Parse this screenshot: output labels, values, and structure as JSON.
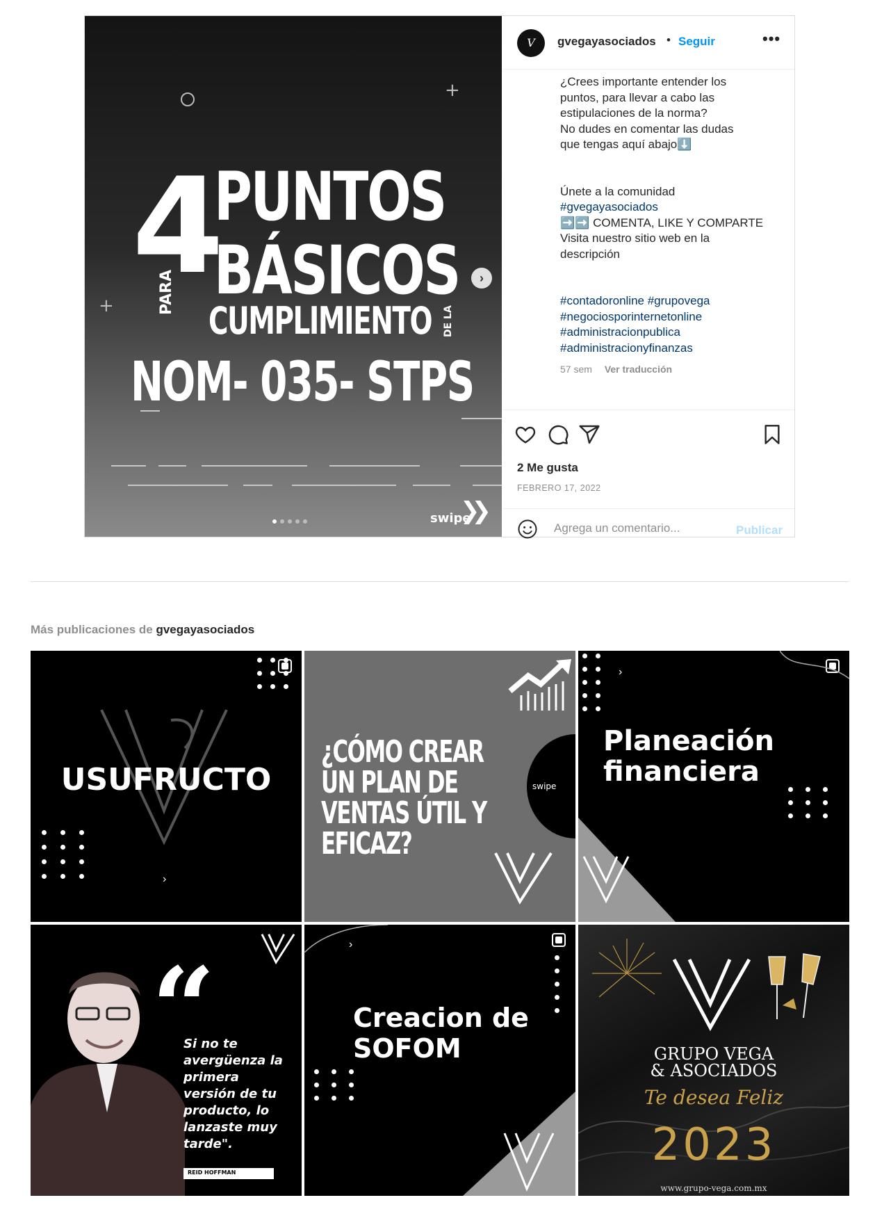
{
  "post": {
    "image": {
      "big_number": "4",
      "line1": "PUNTOS",
      "line2": "BÁSICOS",
      "para": "PARA",
      "line3": "CUMPLIMIENTO",
      "de_la": "DE LA",
      "line4": "NOM- 035- STPS",
      "swipe": "swipe",
      "carousel_slides": 5,
      "carousel_active_index": 0
    },
    "header": {
      "username": "gvegayasociados",
      "separator": "•",
      "follow_label": "Seguir",
      "more_label": "•••"
    },
    "caption": {
      "paragraph1": "¿Crees importante entender los\npuntos, para llevar a cabo las\nestipulaciones de la norma?\nNo dudes en comentar las dudas\nque tengas aquí abajo⬇️",
      "join_text": "Únete a la comunidad",
      "community_tag": "#gvegayasociados",
      "cta_text": "COMENTA, LIKE Y COMPARTE",
      "cta_emoji": "➡️➡️",
      "website_text": "Visita nuestro sitio web en la\ndescripción",
      "hashtags": [
        "#contadoronline #grupovega",
        "#negociosporinternetonline",
        "#administracionpublica",
        "#administracionyfinanzas"
      ]
    },
    "meta": {
      "age": "57 sem",
      "translate_label": "Ver traducción"
    },
    "likes": "2 Me gusta",
    "date": "FEBRERO 17, 2022",
    "comment": {
      "placeholder": "Agrega un comentario...",
      "value": "",
      "publish_label": "Publicar"
    }
  },
  "more_posts": {
    "title_prefix": "Más publicaciones de",
    "owner": "gvegayasociados",
    "tiles": [
      {
        "text": "USUFRUCTO",
        "multi": true
      },
      {
        "text": "¿CÓMO CREAR UN PLAN DE VENTAS ÚTIL Y EFICAZ?",
        "badge": "swipe",
        "multi": false
      },
      {
        "text": "Planeación financiera",
        "multi": true
      },
      {
        "quote": "Si no te avergüenza la primera versión de tu producto, lo lanzaste muy tarde\".",
        "author": "REID HOFFMAN",
        "multi": false
      },
      {
        "text": "Creacion de SOFOM",
        "multi": true
      },
      {
        "brand": "GRUPO VEGA & ASOCIADOS",
        "greeting": "Te desea Feliz",
        "year": "2023",
        "website": "www.grupo-vega.com.mx",
        "multi": false
      }
    ]
  },
  "colors": {
    "accent": "#0095f6",
    "link": "#00376b",
    "muted": "#8e8e8e",
    "publish_disabled": "#b2dffc"
  }
}
